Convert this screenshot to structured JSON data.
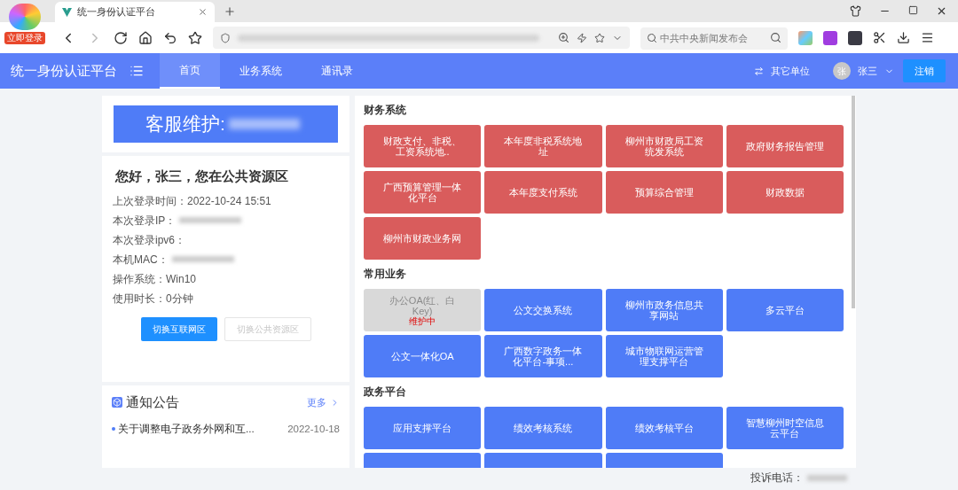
{
  "browser": {
    "login_badge": "立即登录",
    "tab_title": "统一身份认证平台",
    "search": {
      "placeholder": "中共中央新闻发布会"
    }
  },
  "header": {
    "title": "统一身份认证平台",
    "nav": [
      {
        "label": "首页",
        "selected": true
      },
      {
        "label": "业务系统",
        "selected": false
      },
      {
        "label": "通讯录",
        "selected": false
      }
    ],
    "switch_unit": "其它单位",
    "avatar": "张",
    "user": "张三",
    "logout": "注销"
  },
  "service": {
    "label": "客服维护:"
  },
  "profile": {
    "greeting": "您好，张三，您在公共资源区",
    "fields": [
      {
        "label": "上次登录时间：",
        "value": "2022-10-24 15:51",
        "blurred": false
      },
      {
        "label": "本次登录IP：",
        "blurred": true
      },
      {
        "label": "本次登录ipv6：",
        "blurred": false
      },
      {
        "label": "本机MAC：",
        "blurred": true
      },
      {
        "label": "操作系统：",
        "value": "Win10",
        "blurred": false
      },
      {
        "label": "使用时长：",
        "value": "0分钟",
        "blurred": false
      }
    ],
    "buttons": [
      {
        "label": "切换互联网区",
        "disabled": false
      },
      {
        "label": "切换公共资源区",
        "disabled": true
      }
    ]
  },
  "notices": {
    "title": "通知公告",
    "more": "更多",
    "items": [
      {
        "title": "关于调整电子政务外网和互...",
        "date": "2022-10-18"
      }
    ]
  },
  "sections": [
    {
      "title": "财务系统",
      "tiles": [
        {
          "label": "财政支付、非税、工资系统地..",
          "kind": "finance"
        },
        {
          "label": "本年度非税系统地址",
          "kind": "finance"
        },
        {
          "label": "柳州市财政局工资统发系统",
          "kind": "finance"
        },
        {
          "label": "政府财务报告管理",
          "kind": "finance"
        },
        {
          "label": "广西预算管理一体化平台",
          "kind": "finance"
        },
        {
          "label": "本年度支付系统",
          "kind": "finance"
        },
        {
          "label": "预算综合管理",
          "kind": "finance"
        },
        {
          "label": "财政数据",
          "kind": "finance"
        },
        {
          "label": "柳州市财政业务网",
          "kind": "finance"
        }
      ]
    },
    {
      "title": "常用业务",
      "tiles": [
        {
          "label": "办公OA(红、白Key)",
          "kind": "maintenance",
          "status": "维护中"
        },
        {
          "label": "公文交换系统",
          "kind": "normal"
        },
        {
          "label": "柳州市政务信息共享网站",
          "kind": "normal"
        },
        {
          "label": "多云平台",
          "kind": "normal"
        },
        {
          "label": "公文一体化OA",
          "kind": "normal"
        },
        {
          "label": "广西数字政务一体化平台-事项...",
          "kind": "normal"
        },
        {
          "label": "城市物联网运营管理支撑平台",
          "kind": "normal"
        }
      ]
    },
    {
      "title": "政务平台",
      "tiles": [
        {
          "label": "应用支撑平台",
          "kind": "normal"
        },
        {
          "label": "绩效考核系统",
          "kind": "normal"
        },
        {
          "label": "绩效考核平台",
          "kind": "normal"
        },
        {
          "label": "智慧柳州时空信息云平台",
          "kind": "normal"
        },
        {
          "kind": "cut"
        },
        {
          "kind": "cut"
        },
        {
          "kind": "cut"
        }
      ]
    }
  ],
  "footer": {
    "complaint": "投诉电话："
  }
}
